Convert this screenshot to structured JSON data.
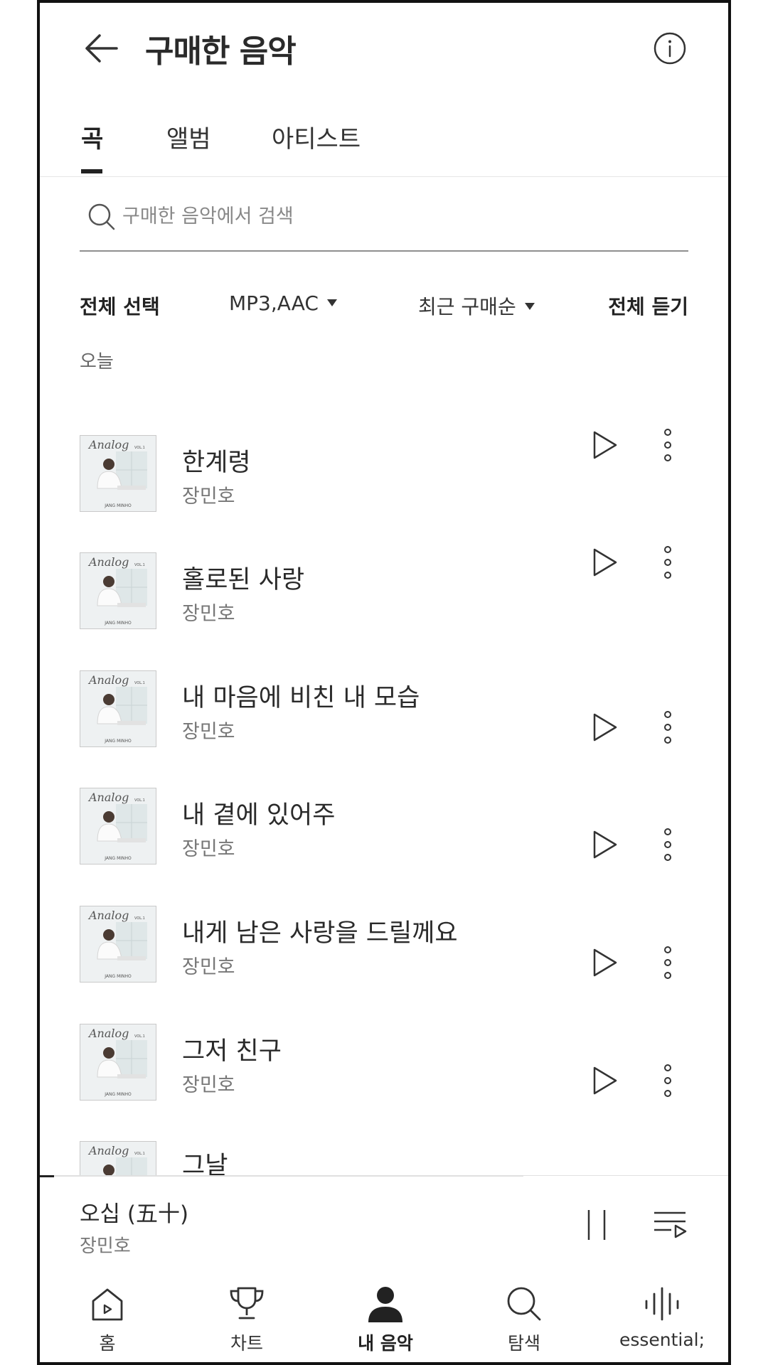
{
  "header": {
    "title": "구매한 음악"
  },
  "tabs": [
    {
      "label": "곡",
      "active": true
    },
    {
      "label": "앨범",
      "active": false
    },
    {
      "label": "아티스트",
      "active": false
    }
  ],
  "search": {
    "placeholder": "구매한 음악에서 검색",
    "value": ""
  },
  "filters": {
    "select_all": "전체 선택",
    "format": "MP3,AAC",
    "sort": "최근 구매순",
    "play_all": "전체 듣기"
  },
  "section_label": "오늘",
  "tracks": [
    {
      "title": "한계령",
      "artist": "장민호"
    },
    {
      "title": "홀로된 사랑",
      "artist": "장민호"
    },
    {
      "title": "내 마음에 비친 내 모습",
      "artist": "장민호"
    },
    {
      "title": "내 곁에 있어주",
      "artist": "장민호"
    },
    {
      "title": "내게 남은 사랑을 드릴께요",
      "artist": "장민호"
    },
    {
      "title": "그저 친구",
      "artist": "장민호"
    },
    {
      "title": "그날",
      "artist": ""
    }
  ],
  "album_cover_text": {
    "title": "Analog",
    "volume": "VOL.1",
    "artist": "JANG MINHO"
  },
  "mini_player": {
    "title": "오십 (五十)",
    "artist": "장민호"
  },
  "bottom_nav": [
    {
      "label": "홈",
      "icon": "home-icon",
      "active": false
    },
    {
      "label": "차트",
      "icon": "trophy-icon",
      "active": false
    },
    {
      "label": "내 음악",
      "icon": "person-icon",
      "active": true
    },
    {
      "label": "탐색",
      "icon": "search-icon",
      "active": false
    },
    {
      "label": "essential;",
      "icon": "soundwave-icon",
      "active": false
    }
  ],
  "colors": {
    "text_primary": "#222222",
    "text_secondary": "#777777",
    "border": "#e6e6e6"
  }
}
